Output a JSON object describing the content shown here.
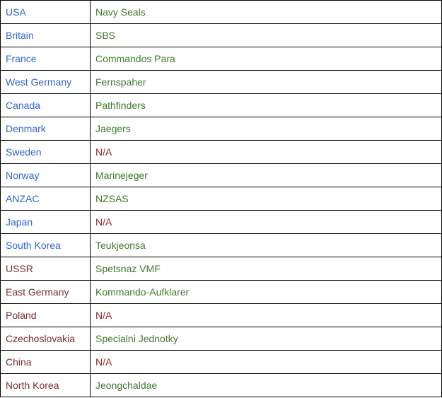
{
  "colors": {
    "nato_country": "#3366cc",
    "pact_country": "#7a2e2e",
    "unit": "#3d7a2e",
    "not_available": "#8b2a2a"
  },
  "rows": [
    {
      "country": "USA",
      "unit": "Navy Seals",
      "side": "nato"
    },
    {
      "country": "Britain",
      "unit": "SBS",
      "side": "nato"
    },
    {
      "country": "France",
      "unit": "Commandos Para",
      "side": "nato"
    },
    {
      "country": "West Germany",
      "unit": "Fernspaher",
      "side": "nato"
    },
    {
      "country": "Canada",
      "unit": "Pathfinders",
      "side": "nato"
    },
    {
      "country": "Denmark",
      "unit": "Jaegers",
      "side": "nato"
    },
    {
      "country": "Sweden",
      "unit": "N/A",
      "side": "nato"
    },
    {
      "country": "Norway",
      "unit": "Marinejeger",
      "side": "nato"
    },
    {
      "country": "ANZAC",
      "unit": "NZSAS",
      "side": "nato"
    },
    {
      "country": "Japan",
      "unit": "N/A",
      "side": "nato"
    },
    {
      "country": "South Korea",
      "unit": "Teukjeonsa",
      "side": "nato"
    },
    {
      "country": "USSR",
      "unit": "Spetsnaz VMF",
      "side": "pact"
    },
    {
      "country": "East Germany",
      "unit": "Kommando-Aufklarer",
      "side": "pact"
    },
    {
      "country": "Poland",
      "unit": "N/A",
      "side": "pact"
    },
    {
      "country": "Czechoslovakia",
      "unit": "Specialni Jednotky",
      "side": "pact"
    },
    {
      "country": "China",
      "unit": "N/A",
      "side": "pact"
    },
    {
      "country": "North Korea",
      "unit": "Jeongchaldae",
      "side": "pact"
    }
  ]
}
